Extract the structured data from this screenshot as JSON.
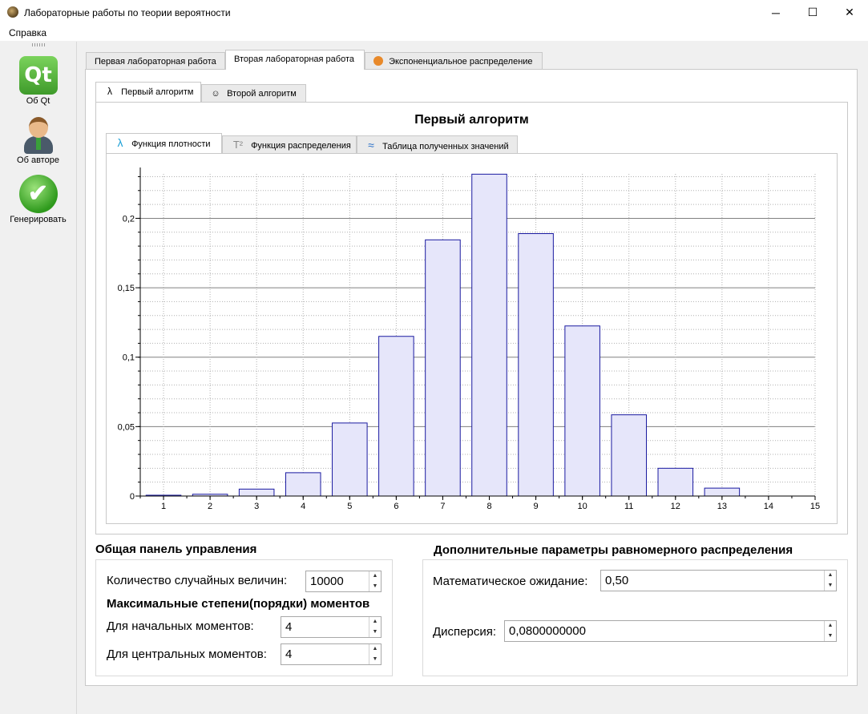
{
  "window": {
    "title": "Лабораторные работы по теории вероятности",
    "minimize": "─",
    "maximize": "☐",
    "close": "✕"
  },
  "menu": {
    "help": "Справка"
  },
  "toolbar": {
    "about_qt": "Об Qt",
    "qt_logo": "Qt",
    "about_author": "Об авторе",
    "generate": "Генерировать",
    "generate_glyph": "✔"
  },
  "main_tabs": [
    {
      "label": "Первая лабораторная работа"
    },
    {
      "label": "Вторая лабораторная работа"
    },
    {
      "label": "Экспоненциальное распределение"
    }
  ],
  "algo_tabs": [
    {
      "label": "Первый алгоритм"
    },
    {
      "label": "Второй алгоритм"
    }
  ],
  "algo_title": "Первый алгоритм",
  "sub_tabs": [
    {
      "label": "Функция плотности",
      "icon": "λ"
    },
    {
      "label": "Функция распределения",
      "icon": "T²"
    },
    {
      "label": "Таблица полученных значений",
      "icon": "≈"
    }
  ],
  "chart_data": {
    "type": "bar",
    "categories": [
      "1",
      "2",
      "3",
      "4",
      "5",
      "6",
      "7",
      "8",
      "9",
      "10",
      "11",
      "12",
      "13",
      "14"
    ],
    "values": [
      0.0006,
      0.0013,
      0.005,
      0.0168,
      0.0526,
      0.115,
      0.1845,
      0.2318,
      0.189,
      0.1225,
      0.0585,
      0.02,
      0.0057,
      0.0
    ],
    "x_ticks": [
      "1",
      "2",
      "3",
      "4",
      "5",
      "6",
      "7",
      "8",
      "9",
      "10",
      "11",
      "12",
      "13",
      "14",
      "15"
    ],
    "y_ticks": [
      {
        "value": 0,
        "label": "0"
      },
      {
        "value": 0.05,
        "label": "0,05"
      },
      {
        "value": 0.1,
        "label": "0,1"
      },
      {
        "value": 0.15,
        "label": "0,15"
      },
      {
        "value": 0.2,
        "label": "0,2"
      }
    ],
    "xlim": [
      0.5,
      15
    ],
    "ylim": [
      0,
      0.232
    ],
    "grid": true,
    "bar_fill": "#e6e6fa",
    "bar_stroke": "#1a1aa0"
  },
  "control_panel": {
    "title": "Общая панель управления",
    "count_label": "Количество случайных величин:",
    "count_value": "10000",
    "moments_title": "Максимальные степени(порядки) моментов",
    "initial_label": "Для начальных моментов:",
    "initial_value": "4",
    "central_label": "Для центральных моментов:",
    "central_value": "4"
  },
  "extra_params": {
    "title": "Дополнительные параметры равномерного распределения",
    "mean_label": "Математическое ожидание:",
    "mean_value": "0,50",
    "variance_label": "Дисперсия:",
    "variance_value": "0,0800000000"
  },
  "spin_up": "▲",
  "spin_down": "▼"
}
